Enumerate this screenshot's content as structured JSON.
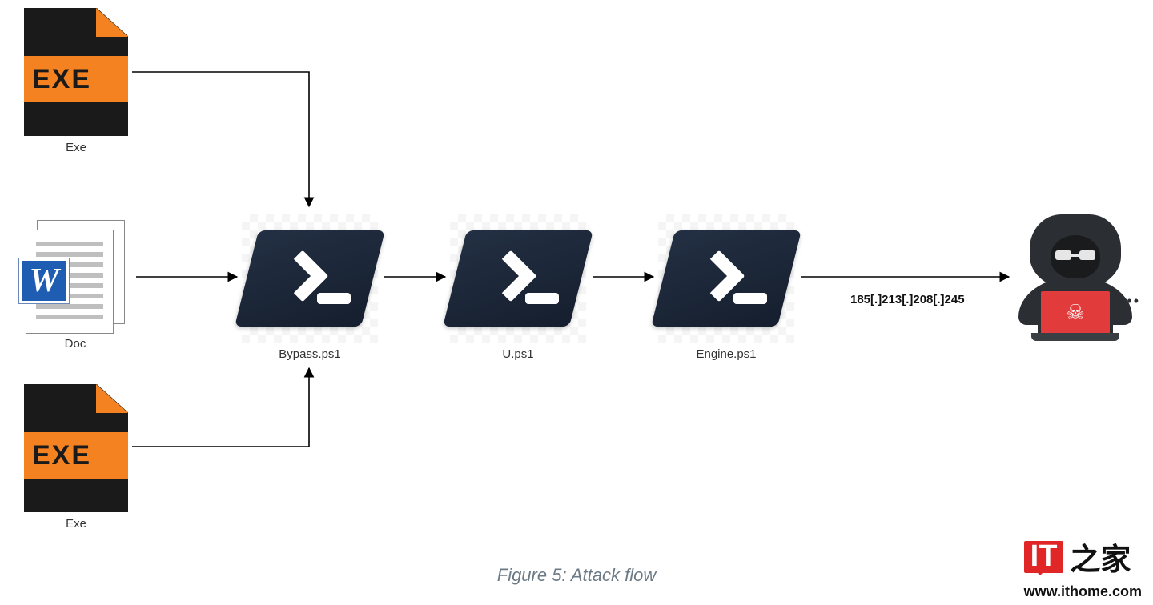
{
  "figure": {
    "caption": "Figure 5: Attack flow"
  },
  "nodes": {
    "exe_top": {
      "label": "Exe",
      "band": "EXE"
    },
    "doc": {
      "label": "Doc",
      "letter": "W"
    },
    "exe_bot": {
      "label": "Exe",
      "band": "EXE"
    },
    "ps1": {
      "label": "Bypass.ps1"
    },
    "ps2": {
      "label": "U.ps1"
    },
    "ps3": {
      "label": "Engine.ps1"
    }
  },
  "edge_text": {
    "ip": "185[.]213[.]208[.]245"
  },
  "watermark": {
    "badge": "IT",
    "suffix": "之家",
    "url": "www.ithome.com"
  }
}
